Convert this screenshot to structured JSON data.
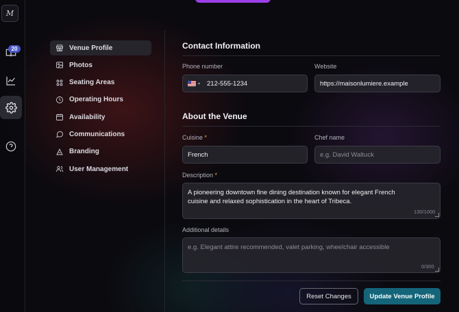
{
  "rail": {
    "logo": "M",
    "badge": "20"
  },
  "nav": {
    "items": [
      {
        "label": "Venue Profile",
        "icon": "storefront-icon"
      },
      {
        "label": "Photos",
        "icon": "image-icon"
      },
      {
        "label": "Seating Areas",
        "icon": "grid-icon"
      },
      {
        "label": "Operating Hours",
        "icon": "clock-icon"
      },
      {
        "label": "Availability",
        "icon": "calendar-icon"
      },
      {
        "label": "Communications",
        "icon": "chat-icon"
      },
      {
        "label": "Branding",
        "icon": "palette-icon"
      },
      {
        "label": "User Management",
        "icon": "users-icon"
      }
    ]
  },
  "contact": {
    "title": "Contact Information",
    "phone_label": "Phone number",
    "phone_value": "212-555-1234",
    "website_label": "Website",
    "website_value": "https://maisonlumiere.example"
  },
  "about": {
    "title": "About the Venue",
    "cuisine_label": "Cuisine",
    "cuisine_value": "French",
    "chef_label": "Chef name",
    "chef_placeholder": "e.g. David Waltuck",
    "description_label": "Description",
    "description_value": "A pioneering downtown fine dining destination known for elegant French cuisine and relaxed sophistication in the heart of Tribeca.",
    "description_counter": "130/1000",
    "additional_label": "Additional details",
    "additional_placeholder": "e.g. Elegant attire recommended, valet parking, wheelchair accessible",
    "additional_counter": "0/300",
    "required_mark": "*"
  },
  "actions": {
    "reset_label": "Reset Changes",
    "update_label": "Update Venue Profile"
  },
  "colors": {
    "accent": "#14657a",
    "badge": "#4a57c9",
    "required": "#f0a43a",
    "top_pill": "#9b3fe6"
  }
}
